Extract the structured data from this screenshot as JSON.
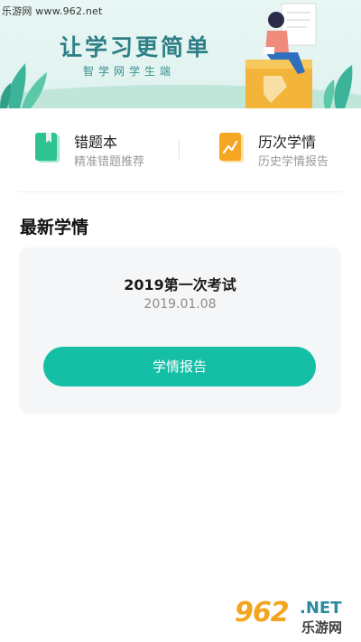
{
  "watermark": {
    "top_text": "乐游网 www.962.net",
    "bottom_num": "962",
    "bottom_net": ".NET",
    "bottom_cn": "乐游网"
  },
  "banner": {
    "slogan": "让学习更简单",
    "sub_slogan": "智学网学生端"
  },
  "entries": [
    {
      "title": "错题本",
      "desc": "精准错题推荐",
      "icon": "notebook-icon",
      "color": "#2fc48f"
    },
    {
      "title": "历次学情",
      "desc": "历史学情报告",
      "icon": "trend-report-icon",
      "color": "#f5a623"
    }
  ],
  "section": {
    "title": "最新学情"
  },
  "latest": {
    "exam_name": "2019第一次考试",
    "exam_date": "2019.01.08",
    "button_label": "学情报告"
  },
  "colors": {
    "accent": "#14bfa6",
    "banner_text": "#2e7f86",
    "card_bg": "#f5f6f8"
  }
}
